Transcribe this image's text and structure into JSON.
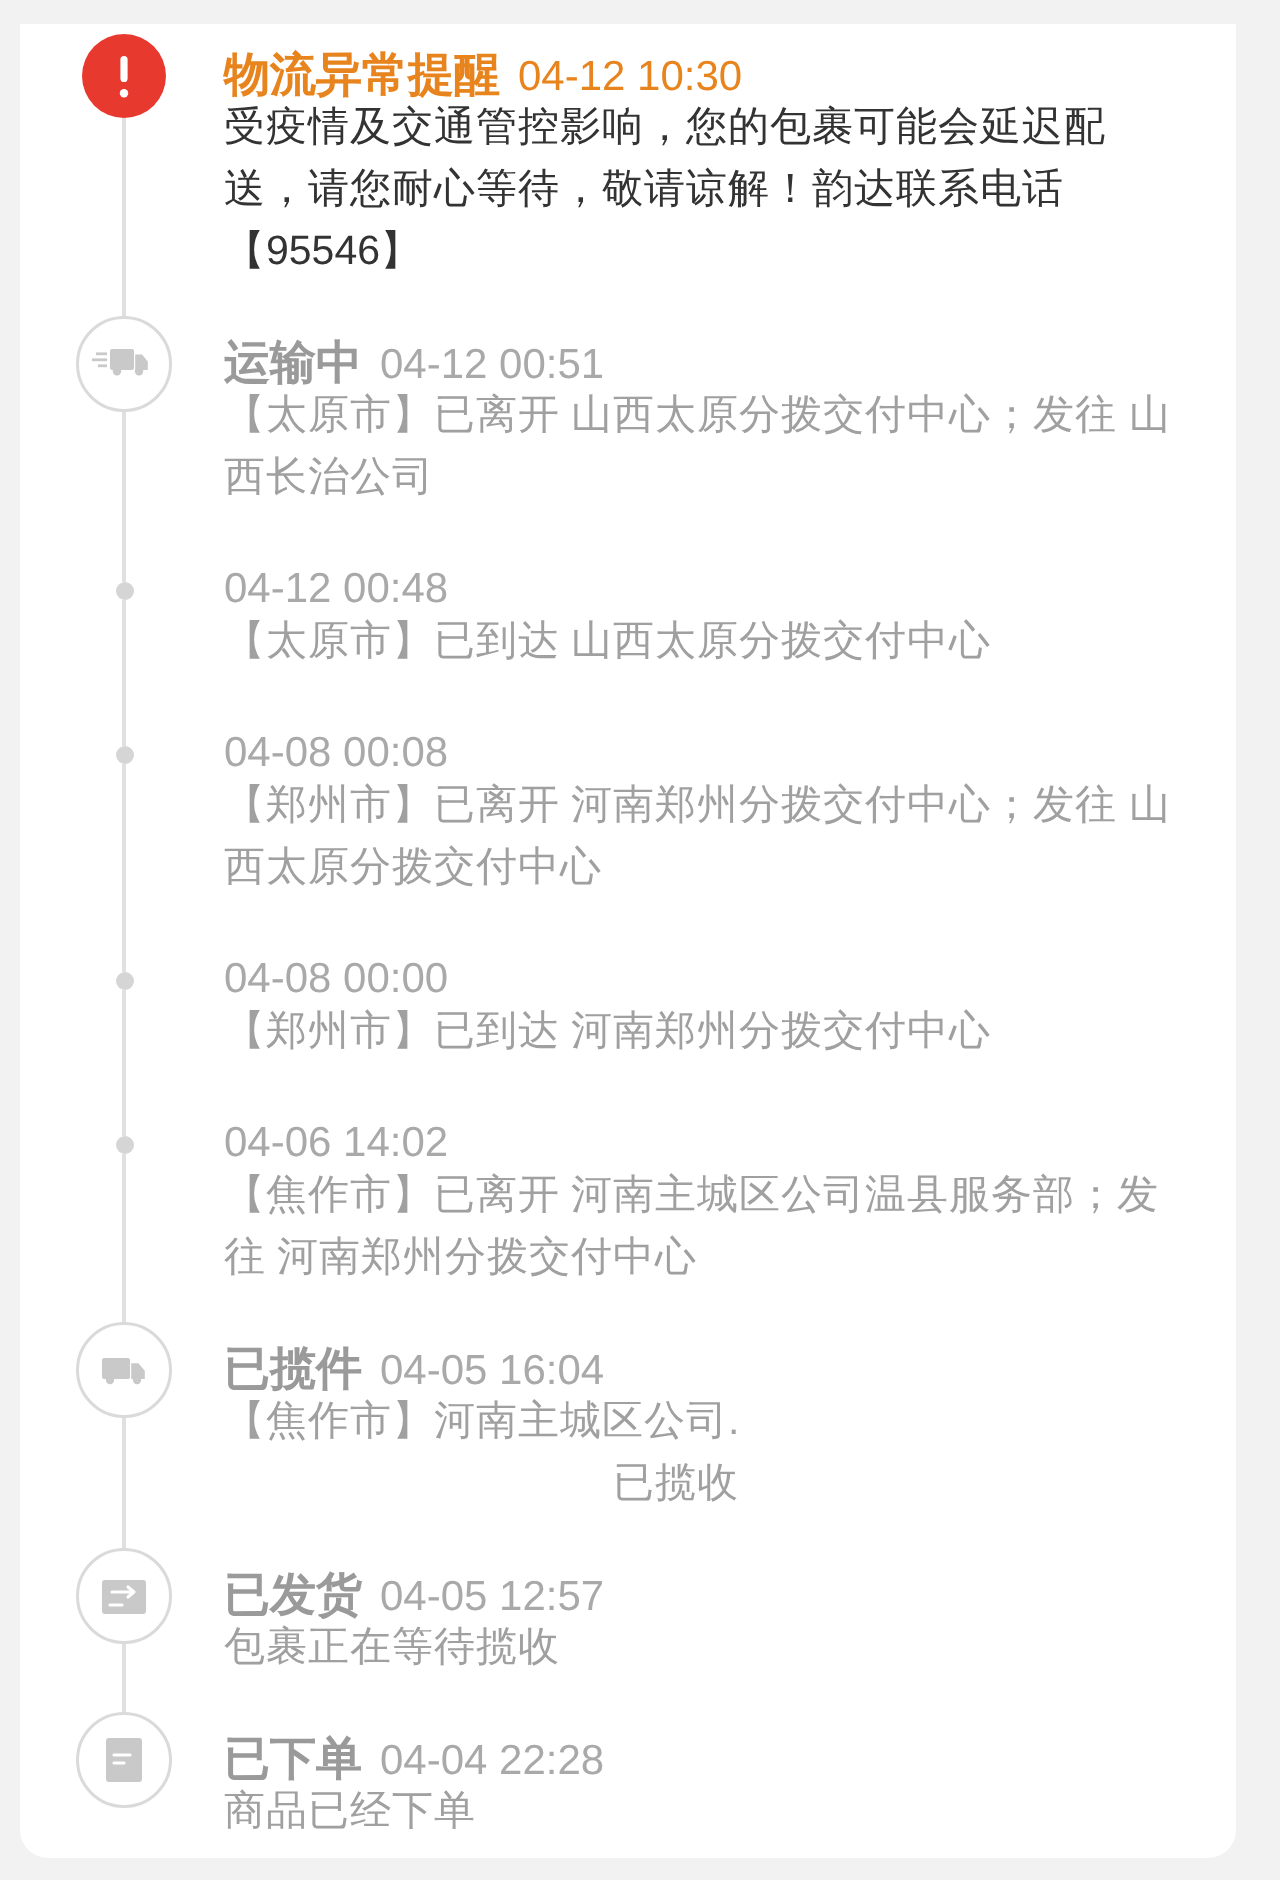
{
  "timeline": [
    {
      "kind": "alert",
      "title": "物流异常提醒",
      "time": "04-12 10:30",
      "body": "受疫情及交通管控影响，您的包裹可能会延迟配送，请您耐心等待，敬请谅解！韵达联系电话【95546】"
    },
    {
      "kind": "transit",
      "title": "运输中",
      "time": "04-12 00:51",
      "body": "【太原市】已离开 山西太原分拨交付中心；发往 山西长治公司"
    },
    {
      "kind": "dot",
      "time": "04-12 00:48",
      "body": "【太原市】已到达 山西太原分拨交付中心"
    },
    {
      "kind": "dot",
      "time": "04-08 00:08",
      "body": "【郑州市】已离开 河南郑州分拨交付中心；发往 山西太原分拨交付中心"
    },
    {
      "kind": "dot",
      "time": "04-08 00:00",
      "body": "【郑州市】已到达 河南郑州分拨交付中心"
    },
    {
      "kind": "dot",
      "time": "04-06 14:02",
      "body": "【焦作市】已离开 河南主城区公司温县服务部；发往 河南郑州分拨交付中心"
    },
    {
      "kind": "pickup",
      "title": "已揽件",
      "time": "04-05 16:04",
      "body": "【焦作市】河南主城区公司.",
      "note": "已揽收"
    },
    {
      "kind": "shipped",
      "title": "已发货",
      "time": "04-05 12:57",
      "body": "包裹正在等待揽收"
    },
    {
      "kind": "ordered",
      "title": "已下单",
      "time": "04-04 22:28",
      "body": "商品已经下单"
    }
  ]
}
